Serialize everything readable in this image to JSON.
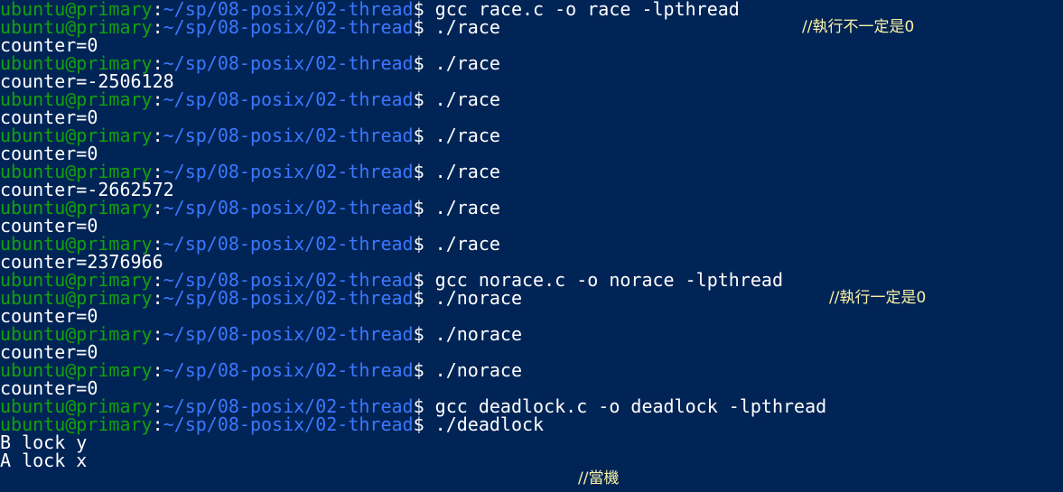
{
  "prompt": {
    "user_host": "ubuntu@primary",
    "separator": ":",
    "path": "~/sp/08-posix/02-thread",
    "symbol": "$ "
  },
  "lines": [
    {
      "type": "cmd",
      "text": "gcc race.c -o race -lpthread"
    },
    {
      "type": "cmd",
      "text": "./race",
      "note": "//執行不一定是0"
    },
    {
      "type": "out",
      "text": "counter=0"
    },
    {
      "type": "cmd",
      "text": "./race"
    },
    {
      "type": "out",
      "text": "counter=-2506128"
    },
    {
      "type": "cmd",
      "text": "./race"
    },
    {
      "type": "out",
      "text": "counter=0"
    },
    {
      "type": "cmd",
      "text": "./race"
    },
    {
      "type": "out",
      "text": "counter=0"
    },
    {
      "type": "cmd",
      "text": "./race"
    },
    {
      "type": "out",
      "text": "counter=-2662572"
    },
    {
      "type": "cmd",
      "text": "./race"
    },
    {
      "type": "out",
      "text": "counter=0"
    },
    {
      "type": "cmd",
      "text": "./race"
    },
    {
      "type": "out",
      "text": "counter=2376966"
    },
    {
      "type": "cmd",
      "text": "gcc norace.c -o norace -lpthread"
    },
    {
      "type": "cmd",
      "text": "./norace",
      "note": "//執行一定是0"
    },
    {
      "type": "out",
      "text": "counter=0"
    },
    {
      "type": "cmd",
      "text": "./norace"
    },
    {
      "type": "out",
      "text": "counter=0"
    },
    {
      "type": "cmd",
      "text": "./norace"
    },
    {
      "type": "out",
      "text": "counter=0"
    },
    {
      "type": "cmd",
      "text": "gcc deadlock.c -o deadlock -lpthread"
    },
    {
      "type": "cmd",
      "text": "./deadlock"
    },
    {
      "type": "out",
      "text": "B lock y"
    },
    {
      "type": "out",
      "text": "A lock x"
    },
    {
      "type": "out",
      "text": "",
      "note": "//當機"
    }
  ],
  "colors": {
    "background": "#012456",
    "user_host": "#13a10e",
    "path": "#3b78ff",
    "text": "#ffffff",
    "annotation": "#f9f1a5"
  }
}
